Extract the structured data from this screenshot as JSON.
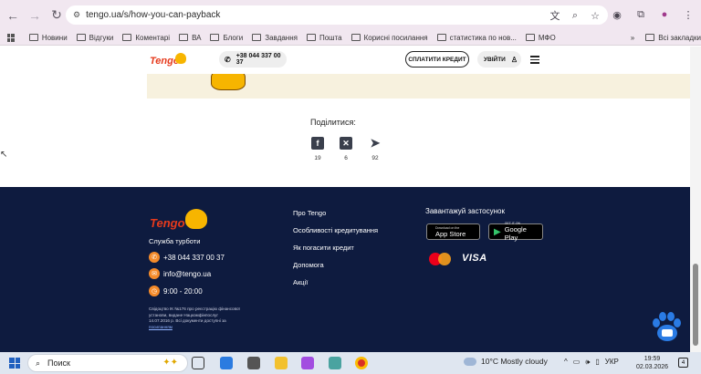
{
  "browser": {
    "url": "tengo.ua/s/how-you-can-payback",
    "bookmarks": [
      "Новини",
      "Відгуки",
      "Коментарі",
      "ВА",
      "Блоги",
      "Завдання",
      "Пошта",
      "Корисні посилання",
      "статистика по нов...",
      "МФО"
    ],
    "all_bookmarks": "Всі закладки",
    "more": "»"
  },
  "header": {
    "logo": "Tengo",
    "phone": "+38 044 337 00 37",
    "pay_button": "СПЛАТИТИ КРЕДИТ",
    "login_button": "УВІЙТИ"
  },
  "share": {
    "title": "Поділитися:",
    "items": [
      {
        "icon": "facebook-icon",
        "count": "19"
      },
      {
        "icon": "x-icon",
        "count": "6"
      },
      {
        "icon": "telegram-icon",
        "count": "92"
      }
    ]
  },
  "footer": {
    "logo": "Tengo",
    "service_title": "Служба турботи",
    "phone": "+38 044 337 00 37",
    "email": "info@tengo.ua",
    "hours": "9:00 - 20:00",
    "legal_text": "Свідоцтво ІК №176 про реєстрацію фінансової установи, видане Нацкомфінпослуг 14.07.2016 р. Всі документи доступні за",
    "legal_link": "посиланням",
    "links": [
      "Про Tengo",
      "Особливості кредитування",
      "Як погасити кредит",
      "Допомога",
      "Акції"
    ],
    "app_title": "Завантажуй застосунок",
    "app_store": {
      "small": "Download on the",
      "big": "App Store"
    },
    "google_play": {
      "small": "GET IT ON",
      "big": "Google Play"
    },
    "visa": "VISA"
  },
  "taskbar": {
    "search": "Поиск",
    "weather": "10°C  Mostly cloudy",
    "lang": "УКР",
    "time": "19:59",
    "date": "02.03.2026",
    "notifications": "4"
  },
  "colors": {
    "footer_bg": "#0e1b3f",
    "accent_orange": "#f58b2a",
    "logo_red": "#e63a1c",
    "beige": "#f7f1de"
  }
}
